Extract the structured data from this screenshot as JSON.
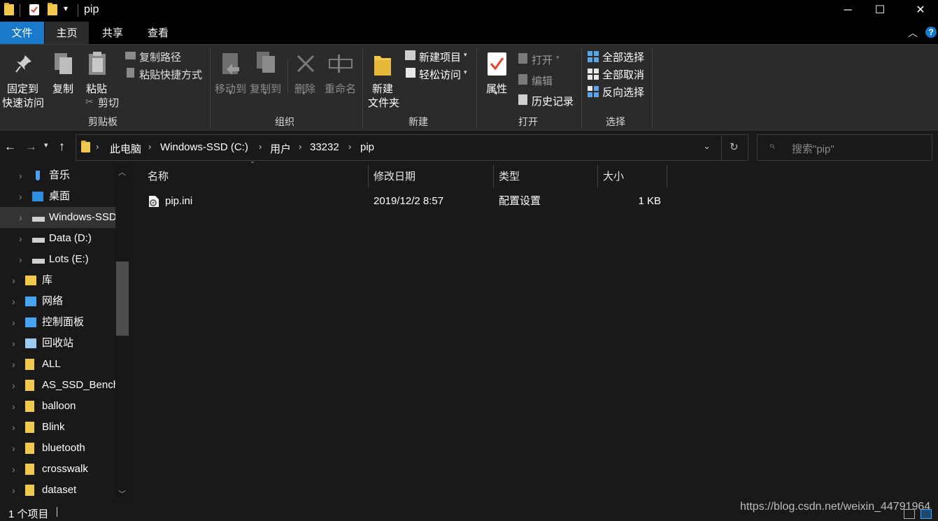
{
  "window": {
    "title": "pip",
    "minimize_glyph": "─",
    "maximize_glyph": "☐",
    "close_glyph": "✕"
  },
  "menu": {
    "file": "文件",
    "home": "主页",
    "share": "共享",
    "view": "查看"
  },
  "ribbon": {
    "clipboard": {
      "pin_line1": "固定到",
      "pin_line2": "快速访问",
      "copy": "复制",
      "paste": "粘贴",
      "copy_path": "复制路径",
      "paste_shortcut": "粘贴快捷方式",
      "cut": "剪切",
      "group": "剪贴板"
    },
    "organize": {
      "move_to": "移动到",
      "copy_to": "复制到",
      "delete": "删除",
      "rename": "重命名",
      "group": "组织"
    },
    "new": {
      "new_folder_line1": "新建",
      "new_folder_line2": "文件夹",
      "new_item": "新建项目",
      "easy_access": "轻松访问",
      "group": "新建"
    },
    "open": {
      "properties": "属性",
      "open": "打开",
      "edit": "编辑",
      "history": "历史记录",
      "group": "打开"
    },
    "select": {
      "select_all": "全部选择",
      "select_none": "全部取消",
      "invert": "反向选择",
      "group": "选择"
    }
  },
  "address": {
    "crumbs": [
      "此电脑",
      "Windows-SSD (C:)",
      "用户",
      "33232",
      "pip"
    ],
    "search_placeholder": "搜索\"pip\""
  },
  "nav": {
    "items": [
      {
        "label": "音乐",
        "icon": "music-icon"
      },
      {
        "label": "桌面",
        "icon": "desktop-icon"
      },
      {
        "label": "Windows-SSD (C:)",
        "icon": "drive-icon",
        "selected": true
      },
      {
        "label": "Data (D:)",
        "icon": "drive-icon"
      },
      {
        "label": "Lots (E:)",
        "icon": "drive-icon"
      },
      {
        "label": "库",
        "icon": "library-icon"
      },
      {
        "label": "网络",
        "icon": "network-icon"
      },
      {
        "label": "控制面板",
        "icon": "control-panel-icon"
      },
      {
        "label": "回收站",
        "icon": "recycle-bin-icon"
      },
      {
        "label": "ALL",
        "icon": "folder-icon"
      },
      {
        "label": "AS_SSD_Benchmark",
        "icon": "folder-icon"
      },
      {
        "label": "balloon",
        "icon": "folder-icon"
      },
      {
        "label": "Blink",
        "icon": "folder-icon"
      },
      {
        "label": "bluetooth",
        "icon": "folder-icon"
      },
      {
        "label": "crosswalk",
        "icon": "folder-icon"
      },
      {
        "label": "dataset",
        "icon": "folder-icon"
      }
    ]
  },
  "file_list": {
    "columns": {
      "name": "名称",
      "modified": "修改日期",
      "type": "类型",
      "size": "大小"
    },
    "rows": [
      {
        "name": "pip.ini",
        "modified": "2019/12/2 8:57",
        "type": "配置设置",
        "size": "1 KB"
      }
    ]
  },
  "status": {
    "count": "1 个项目",
    "watermark": "https://blog.csdn.net/weixin_44791964"
  },
  "colors": {
    "accent": "#1979ca",
    "folder": "#f2c94c",
    "background": "#191919",
    "ribbon": "#2b2b2b"
  }
}
